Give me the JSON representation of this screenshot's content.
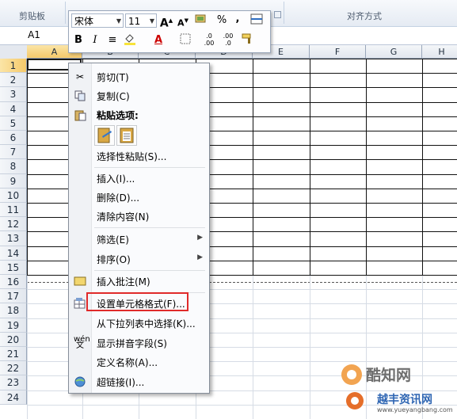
{
  "ribbon": {
    "clipboard_group": "剪贴板",
    "alignment_group": "对齐方式"
  },
  "name_box": "A1",
  "columns": [
    "A",
    "B",
    "C",
    "D",
    "E",
    "F",
    "G",
    "H"
  ],
  "rows": [
    "1",
    "2",
    "3",
    "4",
    "5",
    "6",
    "7",
    "8",
    "9",
    "10",
    "11",
    "12",
    "13",
    "14",
    "15",
    "16",
    "17",
    "18",
    "19",
    "20",
    "21",
    "22",
    "23",
    "24"
  ],
  "mini_toolbar": {
    "font_name": "宋体",
    "font_size": "11",
    "grow_font": "A",
    "shrink_font": "A",
    "percent": "%",
    "comma": ",",
    "bold": "B",
    "italic": "I",
    "font_color": "A",
    "inc_decimal": ".0 .00",
    "dec_decimal": ".00 .0"
  },
  "context_menu": {
    "cut": "剪切(T)",
    "copy": "复制(C)",
    "paste_options": "粘贴选项:",
    "paste_special": "选择性粘贴(S)...",
    "insert": "插入(I)...",
    "delete": "删除(D)...",
    "clear": "清除内容(N)",
    "filter": "筛选(E)",
    "sort": "排序(O)",
    "insert_comment": "插入批注(M)",
    "format_cells": "设置单元格格式(F)...",
    "pick_from_list": "从下拉列表中选择(K)...",
    "phonetic": "显示拼音字段(S)",
    "define_name": "定义名称(A)...",
    "hyperlink": "超链接(I)..."
  },
  "watermark": {
    "brand": "酷知网",
    "sub": "越丰资讯网",
    "url": "www.yueyangbang.com"
  }
}
